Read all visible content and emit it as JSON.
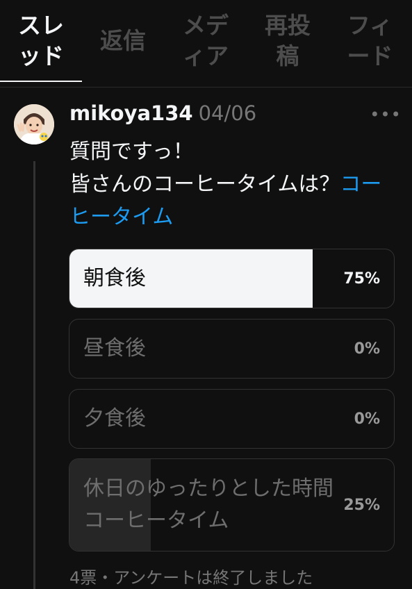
{
  "tabs": [
    {
      "label": "スレ\nッド",
      "active": true
    },
    {
      "label": "返信",
      "active": false
    },
    {
      "label": "メデ\nィア",
      "active": false
    },
    {
      "label": "再投\n稿",
      "active": false
    },
    {
      "label": "フィ\nード",
      "active": false
    }
  ],
  "post": {
    "username": "mikoya134",
    "date": "04/06",
    "more_label": "•••",
    "line1": "質問ですっ！",
    "line2": "皆さんのコーヒータイムは？",
    "hashtag": "コーヒータイム"
  },
  "poll": {
    "options": [
      {
        "label": "朝食後",
        "percent_text": "75%",
        "percent": 75
      },
      {
        "label": "昼食後",
        "percent_text": "0%",
        "percent": 0
      },
      {
        "label": "夕食後",
        "percent_text": "0%",
        "percent": 0
      },
      {
        "label": "休日のゆったりとした時間コーヒータイム",
        "percent_text": "25%",
        "percent": 25
      }
    ],
    "footer": "4票・アンケートは終了しました"
  },
  "colors": {
    "background": "#101010",
    "text": "#f3f5f7",
    "muted": "#777777",
    "link": "#1d9bf0",
    "poll_winner_fill": "#f3f5f7",
    "poll_other_fill": "#262626"
  },
  "icons": {
    "more": "more-horizontal-icon"
  }
}
